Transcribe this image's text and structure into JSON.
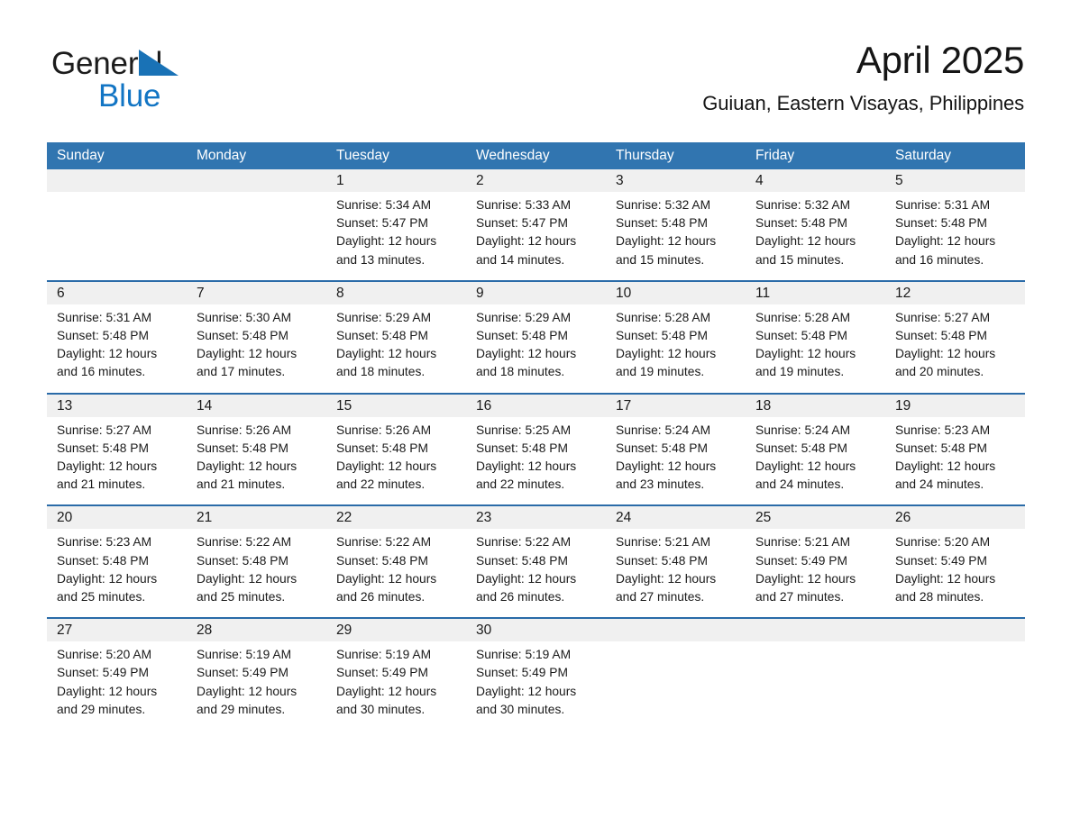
{
  "brand": {
    "name_part1": "General",
    "name_part2": "Blue",
    "triangle_color": "#1972b6",
    "blue_color": "#1275c4"
  },
  "header": {
    "title": "April 2025",
    "subtitle": "Guiuan, Eastern Visayas, Philippines"
  },
  "theme": {
    "header_blue": "#3175b0",
    "row_rule_blue": "#2a6ba8",
    "daynum_band": "#f0f0f0"
  },
  "weekdays": [
    "Sunday",
    "Monday",
    "Tuesday",
    "Wednesday",
    "Thursday",
    "Friday",
    "Saturday"
  ],
  "weeks": [
    {
      "days": [
        {
          "num": "",
          "empty": true
        },
        {
          "num": "",
          "empty": true
        },
        {
          "num": "1",
          "sunrise": "Sunrise: 5:34 AM",
          "sunset": "Sunset: 5:47 PM",
          "daylight": "Daylight: 12 hours and 13 minutes."
        },
        {
          "num": "2",
          "sunrise": "Sunrise: 5:33 AM",
          "sunset": "Sunset: 5:47 PM",
          "daylight": "Daylight: 12 hours and 14 minutes."
        },
        {
          "num": "3",
          "sunrise": "Sunrise: 5:32 AM",
          "sunset": "Sunset: 5:48 PM",
          "daylight": "Daylight: 12 hours and 15 minutes."
        },
        {
          "num": "4",
          "sunrise": "Sunrise: 5:32 AM",
          "sunset": "Sunset: 5:48 PM",
          "daylight": "Daylight: 12 hours and 15 minutes."
        },
        {
          "num": "5",
          "sunrise": "Sunrise: 5:31 AM",
          "sunset": "Sunset: 5:48 PM",
          "daylight": "Daylight: 12 hours and 16 minutes."
        }
      ]
    },
    {
      "days": [
        {
          "num": "6",
          "sunrise": "Sunrise: 5:31 AM",
          "sunset": "Sunset: 5:48 PM",
          "daylight": "Daylight: 12 hours and 16 minutes."
        },
        {
          "num": "7",
          "sunrise": "Sunrise: 5:30 AM",
          "sunset": "Sunset: 5:48 PM",
          "daylight": "Daylight: 12 hours and 17 minutes."
        },
        {
          "num": "8",
          "sunrise": "Sunrise: 5:29 AM",
          "sunset": "Sunset: 5:48 PM",
          "daylight": "Daylight: 12 hours and 18 minutes."
        },
        {
          "num": "9",
          "sunrise": "Sunrise: 5:29 AM",
          "sunset": "Sunset: 5:48 PM",
          "daylight": "Daylight: 12 hours and 18 minutes."
        },
        {
          "num": "10",
          "sunrise": "Sunrise: 5:28 AM",
          "sunset": "Sunset: 5:48 PM",
          "daylight": "Daylight: 12 hours and 19 minutes."
        },
        {
          "num": "11",
          "sunrise": "Sunrise: 5:28 AM",
          "sunset": "Sunset: 5:48 PM",
          "daylight": "Daylight: 12 hours and 19 minutes."
        },
        {
          "num": "12",
          "sunrise": "Sunrise: 5:27 AM",
          "sunset": "Sunset: 5:48 PM",
          "daylight": "Daylight: 12 hours and 20 minutes."
        }
      ]
    },
    {
      "days": [
        {
          "num": "13",
          "sunrise": "Sunrise: 5:27 AM",
          "sunset": "Sunset: 5:48 PM",
          "daylight": "Daylight: 12 hours and 21 minutes."
        },
        {
          "num": "14",
          "sunrise": "Sunrise: 5:26 AM",
          "sunset": "Sunset: 5:48 PM",
          "daylight": "Daylight: 12 hours and 21 minutes."
        },
        {
          "num": "15",
          "sunrise": "Sunrise: 5:26 AM",
          "sunset": "Sunset: 5:48 PM",
          "daylight": "Daylight: 12 hours and 22 minutes."
        },
        {
          "num": "16",
          "sunrise": "Sunrise: 5:25 AM",
          "sunset": "Sunset: 5:48 PM",
          "daylight": "Daylight: 12 hours and 22 minutes."
        },
        {
          "num": "17",
          "sunrise": "Sunrise: 5:24 AM",
          "sunset": "Sunset: 5:48 PM",
          "daylight": "Daylight: 12 hours and 23 minutes."
        },
        {
          "num": "18",
          "sunrise": "Sunrise: 5:24 AM",
          "sunset": "Sunset: 5:48 PM",
          "daylight": "Daylight: 12 hours and 24 minutes."
        },
        {
          "num": "19",
          "sunrise": "Sunrise: 5:23 AM",
          "sunset": "Sunset: 5:48 PM",
          "daylight": "Daylight: 12 hours and 24 minutes."
        }
      ]
    },
    {
      "days": [
        {
          "num": "20",
          "sunrise": "Sunrise: 5:23 AM",
          "sunset": "Sunset: 5:48 PM",
          "daylight": "Daylight: 12 hours and 25 minutes."
        },
        {
          "num": "21",
          "sunrise": "Sunrise: 5:22 AM",
          "sunset": "Sunset: 5:48 PM",
          "daylight": "Daylight: 12 hours and 25 minutes."
        },
        {
          "num": "22",
          "sunrise": "Sunrise: 5:22 AM",
          "sunset": "Sunset: 5:48 PM",
          "daylight": "Daylight: 12 hours and 26 minutes."
        },
        {
          "num": "23",
          "sunrise": "Sunrise: 5:22 AM",
          "sunset": "Sunset: 5:48 PM",
          "daylight": "Daylight: 12 hours and 26 minutes."
        },
        {
          "num": "24",
          "sunrise": "Sunrise: 5:21 AM",
          "sunset": "Sunset: 5:48 PM",
          "daylight": "Daylight: 12 hours and 27 minutes."
        },
        {
          "num": "25",
          "sunrise": "Sunrise: 5:21 AM",
          "sunset": "Sunset: 5:49 PM",
          "daylight": "Daylight: 12 hours and 27 minutes."
        },
        {
          "num": "26",
          "sunrise": "Sunrise: 5:20 AM",
          "sunset": "Sunset: 5:49 PM",
          "daylight": "Daylight: 12 hours and 28 minutes."
        }
      ]
    },
    {
      "days": [
        {
          "num": "27",
          "sunrise": "Sunrise: 5:20 AM",
          "sunset": "Sunset: 5:49 PM",
          "daylight": "Daylight: 12 hours and 29 minutes."
        },
        {
          "num": "28",
          "sunrise": "Sunrise: 5:19 AM",
          "sunset": "Sunset: 5:49 PM",
          "daylight": "Daylight: 12 hours and 29 minutes."
        },
        {
          "num": "29",
          "sunrise": "Sunrise: 5:19 AM",
          "sunset": "Sunset: 5:49 PM",
          "daylight": "Daylight: 12 hours and 30 minutes."
        },
        {
          "num": "30",
          "sunrise": "Sunrise: 5:19 AM",
          "sunset": "Sunset: 5:49 PM",
          "daylight": "Daylight: 12 hours and 30 minutes."
        },
        {
          "num": "",
          "empty": true
        },
        {
          "num": "",
          "empty": true
        },
        {
          "num": "",
          "empty": true
        }
      ]
    }
  ]
}
